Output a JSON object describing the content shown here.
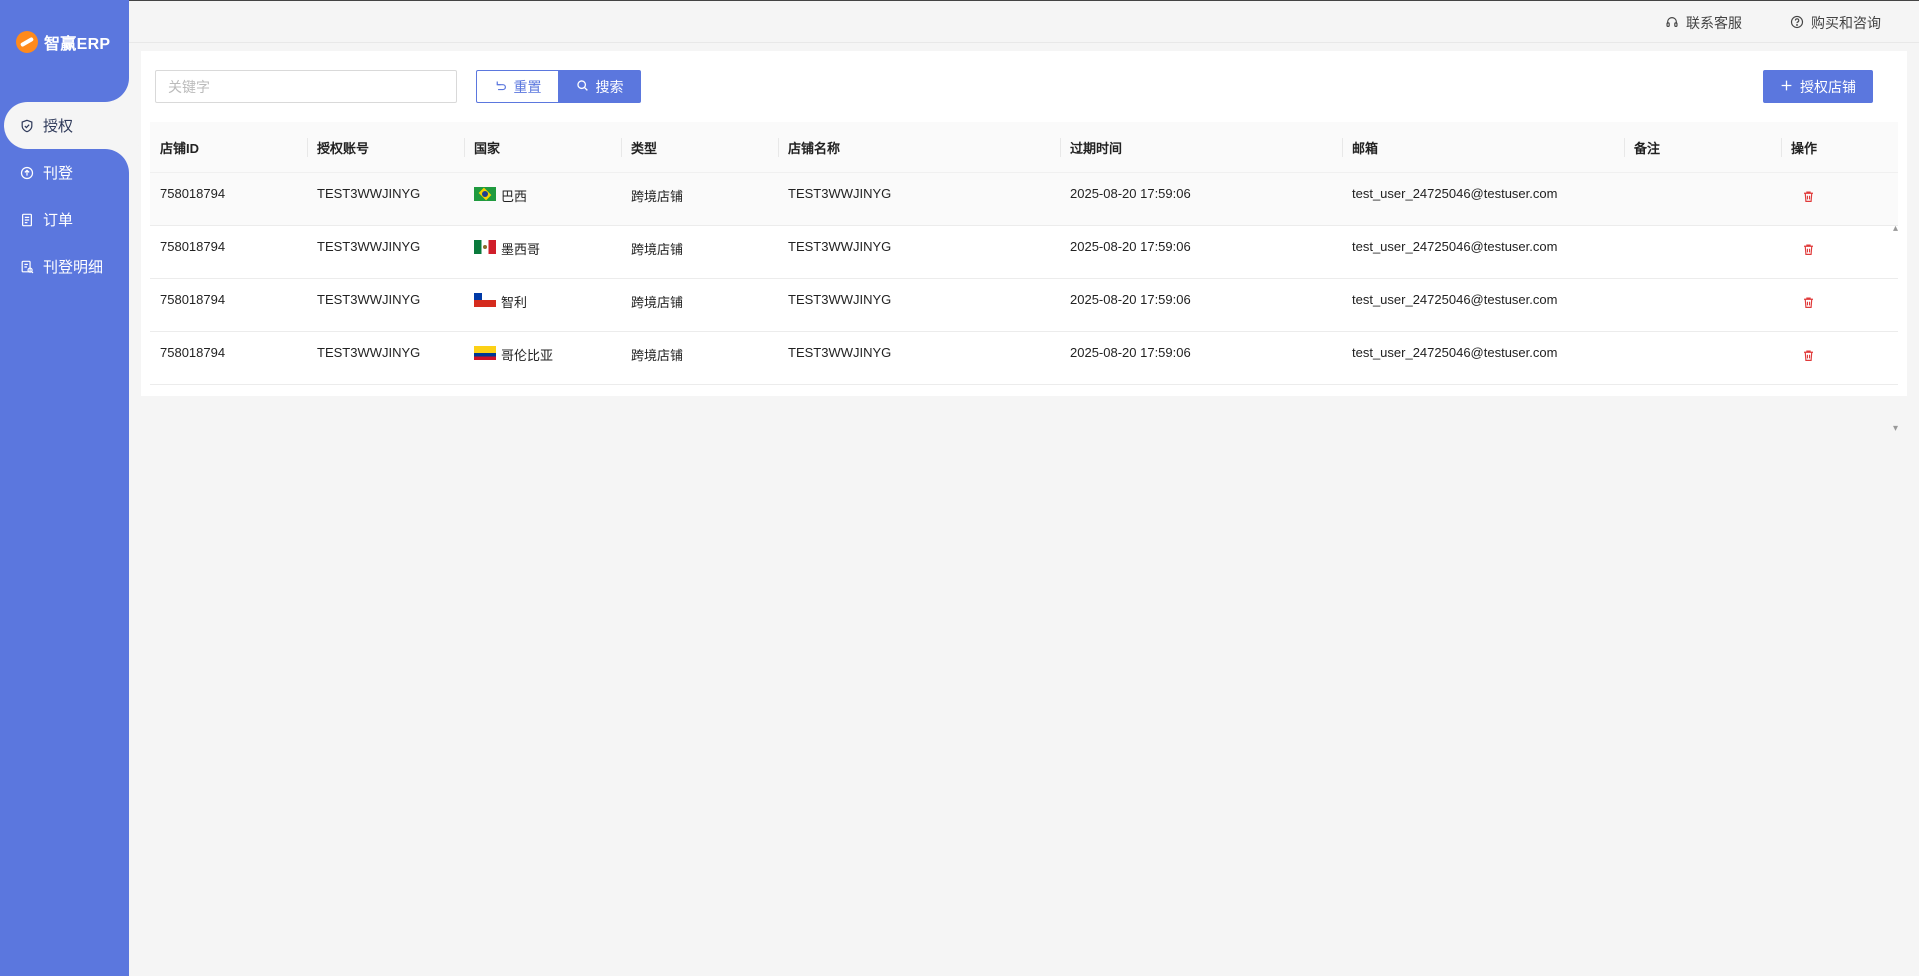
{
  "app": {
    "logo_text": "智赢ERP"
  },
  "sidebar": {
    "items": [
      {
        "label": "授权",
        "icon": "shield-icon",
        "active": true
      },
      {
        "label": "刊登",
        "icon": "upload-circle-icon",
        "active": false
      },
      {
        "label": "订单",
        "icon": "document-icon",
        "active": false
      },
      {
        "label": "刊登明细",
        "icon": "detail-list-icon",
        "active": false
      }
    ]
  },
  "topbar": {
    "support_label": "联系客服",
    "consult_label": "购买和咨询"
  },
  "toolbar": {
    "search_placeholder": "关键字",
    "reset_label": "重置",
    "search_label": "搜索",
    "authorize_label": "授权店铺"
  },
  "table": {
    "headers": [
      "店铺ID",
      "授权账号",
      "国家",
      "类型",
      "店铺名称",
      "过期时间",
      "邮箱",
      "备注",
      "操作"
    ],
    "rows": [
      {
        "store_id": "758018794",
        "account": "TEST3WWJINYG",
        "country": "巴西",
        "flag": "br",
        "type": "跨境店铺",
        "store_name": "TEST3WWJINYG",
        "expire": "2025-08-20 17:59:06",
        "email": "test_user_24725046@testuser.com",
        "note": ""
      },
      {
        "store_id": "758018794",
        "account": "TEST3WWJINYG",
        "country": "墨西哥",
        "flag": "mx",
        "type": "跨境店铺",
        "store_name": "TEST3WWJINYG",
        "expire": "2025-08-20 17:59:06",
        "email": "test_user_24725046@testuser.com",
        "note": ""
      },
      {
        "store_id": "758018794",
        "account": "TEST3WWJINYG",
        "country": "智利",
        "flag": "cl",
        "type": "跨境店铺",
        "store_name": "TEST3WWJINYG",
        "expire": "2025-08-20 17:59:06",
        "email": "test_user_24725046@testuser.com",
        "note": ""
      },
      {
        "store_id": "758018794",
        "account": "TEST3WWJINYG",
        "country": "哥伦比亚",
        "flag": "co",
        "type": "跨境店铺",
        "store_name": "TEST3WWJINYG",
        "expire": "2025-08-20 17:59:06",
        "email": "test_user_24725046@testuser.com",
        "note": ""
      }
    ]
  },
  "colors": {
    "accent": "#5b77de",
    "danger": "#e03a3a"
  }
}
